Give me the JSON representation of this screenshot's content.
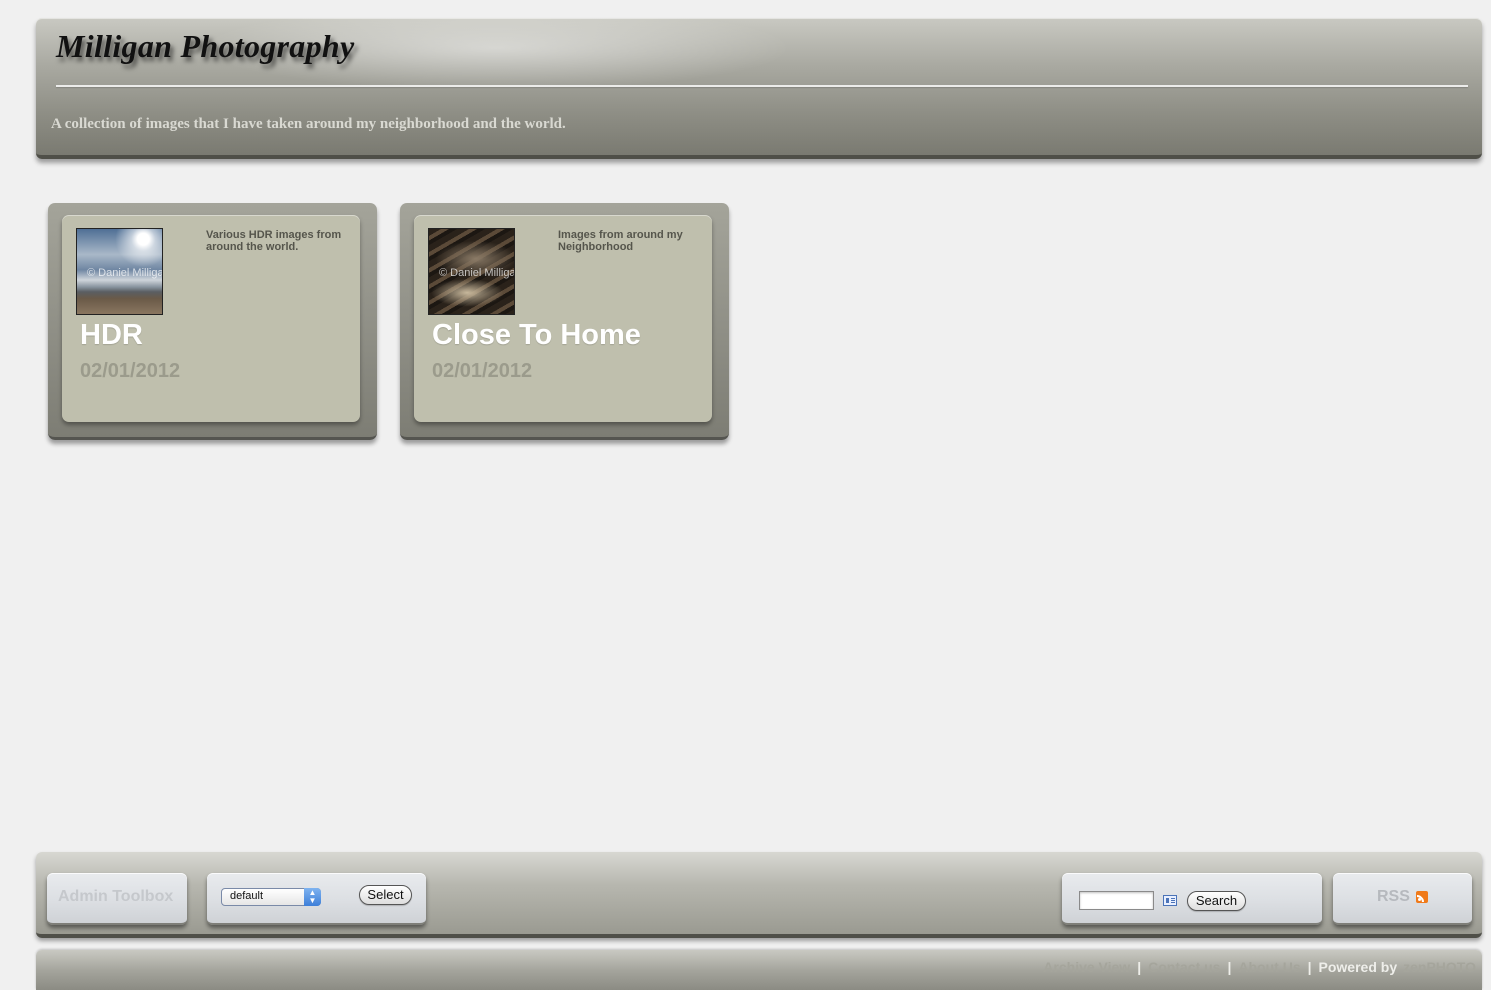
{
  "header": {
    "title": "Milligan Photography",
    "description": "A collection of images that I have taken around my neighborhood and the world."
  },
  "albums": [
    {
      "title": "HDR",
      "date": "02/01/2012",
      "description": "Various HDR images from around the world.",
      "thumb_watermark": "© Daniel Milligan"
    },
    {
      "title": "Close To Home",
      "date": "02/01/2012",
      "description": "Images from around my Neighborhood",
      "thumb_watermark": "© Daniel Milligan"
    }
  ],
  "toolbar": {
    "admin_label": "Admin Toolbox",
    "theme_selected": "default",
    "select_label": "Select",
    "search_value": "",
    "search_label": "Search",
    "rss_label": "RSS"
  },
  "footer": {
    "archive_link": "Archive View",
    "contact_link": "Contact us",
    "about_link": "About Us",
    "powered_by": "Powered by",
    "brand": "zenPHOTO"
  },
  "colors": {
    "background": "#f0f0f0",
    "card_inner": "#bfbfad",
    "rss_orange": "#f07a1a"
  }
}
